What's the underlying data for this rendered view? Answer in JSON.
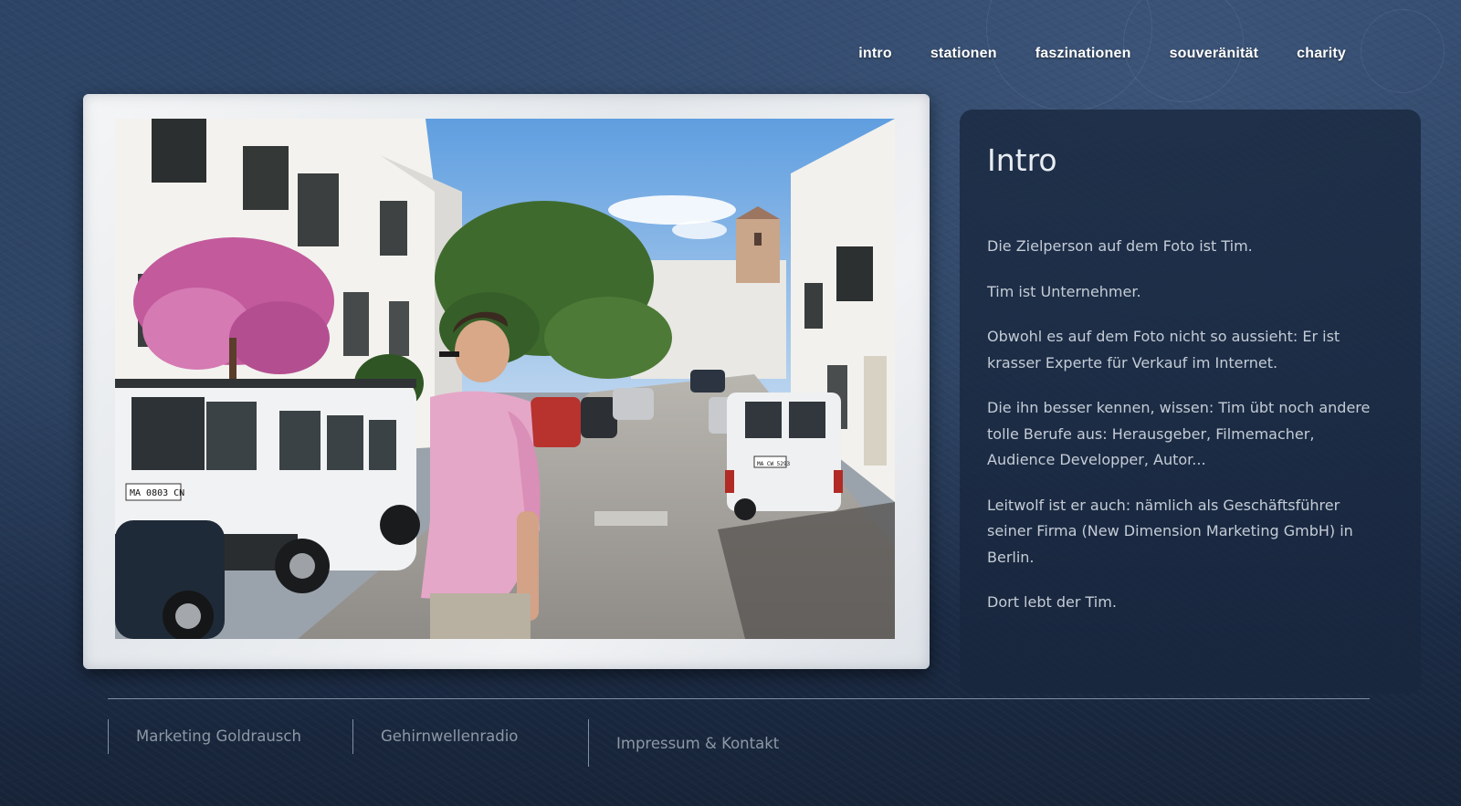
{
  "nav": {
    "items": [
      {
        "label": "intro"
      },
      {
        "label": "stationen"
      },
      {
        "label": "faszinationen"
      },
      {
        "label": "souveränität"
      },
      {
        "label": "charity"
      }
    ]
  },
  "intro": {
    "title": "Intro",
    "paragraphs": [
      "Die Zielperson auf dem Foto ist Tim.",
      "Tim ist Unternehmer.",
      "Obwohl es auf dem Foto nicht so aussieht: Er ist krasser Experte für Verkauf im Internet.",
      "Die ihn besser kennen, wissen: Tim übt noch andere tolle Berufe aus: Herausgeber, Filmemacher, Audience Developper, Autor...",
      "Leitwolf ist er auch: nämlich als Geschäftsführer seiner Firma (New Dimension Marketing GmbH) in Berlin.",
      "Dort lebt der Tim."
    ]
  },
  "photo": {
    "plate_left": "MA 0803 CN",
    "plate_right": "MA CW 5293"
  },
  "footer": {
    "links": [
      {
        "label": "Marketing Goldrausch"
      },
      {
        "label": "Gehirnwellenradio"
      },
      {
        "label": "Impressum & Kontakt"
      }
    ]
  },
  "colors": {
    "background": "#243957",
    "panel": "#18263e",
    "nav_text": "#ffffff",
    "body_text": "#c4ccd6",
    "footer_text": "#8d98a6"
  }
}
